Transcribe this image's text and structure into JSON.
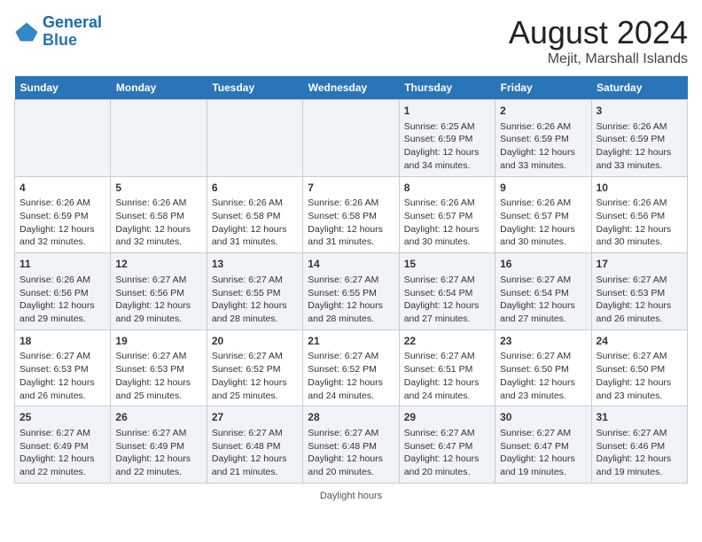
{
  "logo": {
    "line1": "General",
    "line2": "Blue"
  },
  "title": "August 2024",
  "subtitle": "Mejit, Marshall Islands",
  "days_header": [
    "Sunday",
    "Monday",
    "Tuesday",
    "Wednesday",
    "Thursday",
    "Friday",
    "Saturday"
  ],
  "weeks": [
    [
      {
        "day": "",
        "info": ""
      },
      {
        "day": "",
        "info": ""
      },
      {
        "day": "",
        "info": ""
      },
      {
        "day": "",
        "info": ""
      },
      {
        "day": "1",
        "info": "Sunrise: 6:25 AM\nSunset: 6:59 PM\nDaylight: 12 hours and 34 minutes."
      },
      {
        "day": "2",
        "info": "Sunrise: 6:26 AM\nSunset: 6:59 PM\nDaylight: 12 hours and 33 minutes."
      },
      {
        "day": "3",
        "info": "Sunrise: 6:26 AM\nSunset: 6:59 PM\nDaylight: 12 hours and 33 minutes."
      }
    ],
    [
      {
        "day": "4",
        "info": "Sunrise: 6:26 AM\nSunset: 6:59 PM\nDaylight: 12 hours and 32 minutes."
      },
      {
        "day": "5",
        "info": "Sunrise: 6:26 AM\nSunset: 6:58 PM\nDaylight: 12 hours and 32 minutes."
      },
      {
        "day": "6",
        "info": "Sunrise: 6:26 AM\nSunset: 6:58 PM\nDaylight: 12 hours and 31 minutes."
      },
      {
        "day": "7",
        "info": "Sunrise: 6:26 AM\nSunset: 6:58 PM\nDaylight: 12 hours and 31 minutes."
      },
      {
        "day": "8",
        "info": "Sunrise: 6:26 AM\nSunset: 6:57 PM\nDaylight: 12 hours and 30 minutes."
      },
      {
        "day": "9",
        "info": "Sunrise: 6:26 AM\nSunset: 6:57 PM\nDaylight: 12 hours and 30 minutes."
      },
      {
        "day": "10",
        "info": "Sunrise: 6:26 AM\nSunset: 6:56 PM\nDaylight: 12 hours and 30 minutes."
      }
    ],
    [
      {
        "day": "11",
        "info": "Sunrise: 6:26 AM\nSunset: 6:56 PM\nDaylight: 12 hours and 29 minutes."
      },
      {
        "day": "12",
        "info": "Sunrise: 6:27 AM\nSunset: 6:56 PM\nDaylight: 12 hours and 29 minutes."
      },
      {
        "day": "13",
        "info": "Sunrise: 6:27 AM\nSunset: 6:55 PM\nDaylight: 12 hours and 28 minutes."
      },
      {
        "day": "14",
        "info": "Sunrise: 6:27 AM\nSunset: 6:55 PM\nDaylight: 12 hours and 28 minutes."
      },
      {
        "day": "15",
        "info": "Sunrise: 6:27 AM\nSunset: 6:54 PM\nDaylight: 12 hours and 27 minutes."
      },
      {
        "day": "16",
        "info": "Sunrise: 6:27 AM\nSunset: 6:54 PM\nDaylight: 12 hours and 27 minutes."
      },
      {
        "day": "17",
        "info": "Sunrise: 6:27 AM\nSunset: 6:53 PM\nDaylight: 12 hours and 26 minutes."
      }
    ],
    [
      {
        "day": "18",
        "info": "Sunrise: 6:27 AM\nSunset: 6:53 PM\nDaylight: 12 hours and 26 minutes."
      },
      {
        "day": "19",
        "info": "Sunrise: 6:27 AM\nSunset: 6:53 PM\nDaylight: 12 hours and 25 minutes."
      },
      {
        "day": "20",
        "info": "Sunrise: 6:27 AM\nSunset: 6:52 PM\nDaylight: 12 hours and 25 minutes."
      },
      {
        "day": "21",
        "info": "Sunrise: 6:27 AM\nSunset: 6:52 PM\nDaylight: 12 hours and 24 minutes."
      },
      {
        "day": "22",
        "info": "Sunrise: 6:27 AM\nSunset: 6:51 PM\nDaylight: 12 hours and 24 minutes."
      },
      {
        "day": "23",
        "info": "Sunrise: 6:27 AM\nSunset: 6:50 PM\nDaylight: 12 hours and 23 minutes."
      },
      {
        "day": "24",
        "info": "Sunrise: 6:27 AM\nSunset: 6:50 PM\nDaylight: 12 hours and 23 minutes."
      }
    ],
    [
      {
        "day": "25",
        "info": "Sunrise: 6:27 AM\nSunset: 6:49 PM\nDaylight: 12 hours and 22 minutes."
      },
      {
        "day": "26",
        "info": "Sunrise: 6:27 AM\nSunset: 6:49 PM\nDaylight: 12 hours and 22 minutes."
      },
      {
        "day": "27",
        "info": "Sunrise: 6:27 AM\nSunset: 6:48 PM\nDaylight: 12 hours and 21 minutes."
      },
      {
        "day": "28",
        "info": "Sunrise: 6:27 AM\nSunset: 6:48 PM\nDaylight: 12 hours and 20 minutes."
      },
      {
        "day": "29",
        "info": "Sunrise: 6:27 AM\nSunset: 6:47 PM\nDaylight: 12 hours and 20 minutes."
      },
      {
        "day": "30",
        "info": "Sunrise: 6:27 AM\nSunset: 6:47 PM\nDaylight: 12 hours and 19 minutes."
      },
      {
        "day": "31",
        "info": "Sunrise: 6:27 AM\nSunset: 6:46 PM\nDaylight: 12 hours and 19 minutes."
      }
    ]
  ],
  "footer": "Daylight hours"
}
